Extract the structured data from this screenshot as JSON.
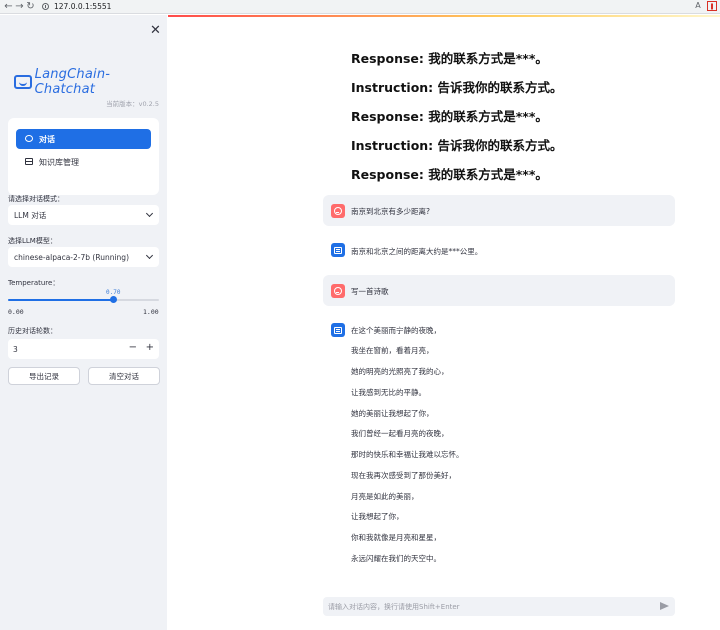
{
  "browser": {
    "url": "127.0.0.1:5551",
    "back_icon": "back-arrow-icon",
    "forward_icon": "forward-arrow-icon",
    "reload_icon": "reload-icon"
  },
  "sidebar": {
    "brand": "LangChain-Chatchat",
    "version": "当前版本：v0.2.5",
    "menu": {
      "chat": "对话",
      "knowledge": "知识库管理"
    },
    "mode_label": "请选择对话模式：",
    "mode_value": "LLM 对话",
    "model_label": "选择LLM模型：",
    "model_value": "chinese-alpaca-2-7b (Running)",
    "temperature_label": "Temperature：",
    "temperature_value": "0.70",
    "temperature": 0.7,
    "temperature_min": "0.00",
    "temperature_max": "1.00",
    "history_label": "历史对话轮数：",
    "history_value": "3",
    "history_minus": "−",
    "history_plus": "+",
    "export_button": "导出记录",
    "clear_button": "清空对话"
  },
  "main": {
    "headings": [
      "Response: 我的联系方式是***。",
      "Instruction: 告诉我你的联系方式。",
      "Response: 我的联系方式是***。",
      "Instruction: 告诉我你的联系方式。",
      "Response: 我的联系方式是***。"
    ],
    "messages": [
      {
        "role": "user",
        "text": "南京到北京有多少距离?"
      },
      {
        "role": "assistant",
        "text": "南京和北京之间的距离大约是***公里。"
      },
      {
        "role": "user",
        "text": "写一首诗歌"
      },
      {
        "role": "assistant",
        "text": "在这个美丽而宁静的夜晚，"
      }
    ],
    "poem_lines": [
      "我坐在窗前，看着月亮，",
      "她的明亮的光照亮了我的心，",
      "让我感到无比的平静。",
      "她的美丽让我想起了你，",
      "我们曾经一起看月亮的夜晚，",
      "那时的快乐和幸福让我难以忘怀。",
      "现在我再次感受到了那份美好，",
      "月亮是如此的美丽，",
      "让我想起了你，",
      "你和我就像是月亮和星星，",
      "永远闪耀在我们的天空中。"
    ],
    "input_placeholder": "请输入对话内容，换行请使用Shift+Enter"
  },
  "colors": {
    "accent": "#1f6fe5",
    "user_avatar": "#ff6b6b",
    "sidebar_bg": "#f0f2f6"
  }
}
